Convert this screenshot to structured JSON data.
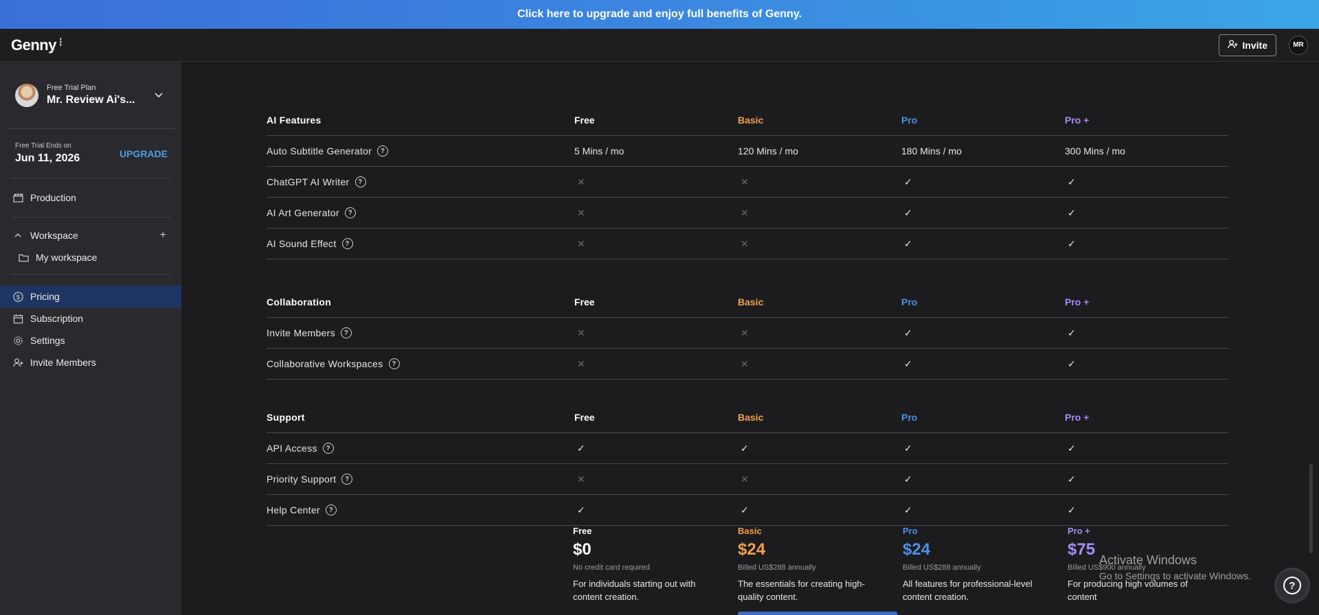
{
  "banner": {
    "text": "Click here to upgrade and enjoy full benefits of Genny."
  },
  "header": {
    "logo": "Genny",
    "invite_label": "Invite",
    "avatar_initials": "MR"
  },
  "sidebar": {
    "plan_label": "Free Trial Plan",
    "plan_name": "Mr. Review Ai's...",
    "trial_label": "Free Trial Ends on",
    "trial_date": "Jun 11, 2026",
    "upgrade_label": "UPGRADE",
    "production_label": "Production",
    "workspace_label": "Workspace",
    "my_workspace_label": "My workspace",
    "pricing_label": "Pricing",
    "subscription_label": "Subscription",
    "settings_label": "Settings",
    "invite_members_label": "Invite Members"
  },
  "plans_header": {
    "free": "Free",
    "basic": "Basic",
    "pro": "Pro",
    "proplus": "Pro +"
  },
  "ai_features": {
    "title": "AI Features",
    "rows": [
      {
        "label": "Auto Subtitle Generator",
        "free": "5 Mins / mo",
        "basic": "120 Mins / mo",
        "pro": "180 Mins / mo",
        "proplus": "300 Mins / mo"
      },
      {
        "label": "ChatGPT AI Writer"
      },
      {
        "label": "AI Art Generator"
      },
      {
        "label": "AI Sound Effect"
      }
    ]
  },
  "collaboration": {
    "title": "Collaboration",
    "rows": [
      {
        "label": "Invite Members"
      },
      {
        "label": "Collaborative Workspaces"
      }
    ]
  },
  "support": {
    "title": "Support",
    "rows": [
      {
        "label": "API Access"
      },
      {
        "label": "Priority Support"
      },
      {
        "label": "Help Center"
      }
    ]
  },
  "plan_cards": [
    {
      "name": "Free",
      "price": "$0",
      "note": "No credit card required",
      "desc": "For individuals starting out with content creation."
    },
    {
      "name": "Basic",
      "price": "$24",
      "note": "Billed US$288 annually",
      "desc": "The essentials for creating high-quality content."
    },
    {
      "name": "Pro",
      "price": "$24",
      "note": "Billed US$288 annually",
      "desc": "All features for professional-level content creation."
    },
    {
      "name": "Pro +",
      "price": "$75",
      "note": "Billed US$900 annually",
      "desc": "For producing high volumes of content"
    }
  ],
  "watermark": {
    "line1": "Activate Windows",
    "line2": "Go to Settings to activate Windows."
  },
  "icons": {
    "check": "check-icon",
    "cross": "cross-icon",
    "help": "question-circle-icon"
  },
  "colors": {
    "basic": "#f0a04b",
    "pro": "#4d8fe8",
    "proplus": "#a78bfa",
    "banner": "#3b86e0",
    "active_nav": "#1e3563"
  }
}
